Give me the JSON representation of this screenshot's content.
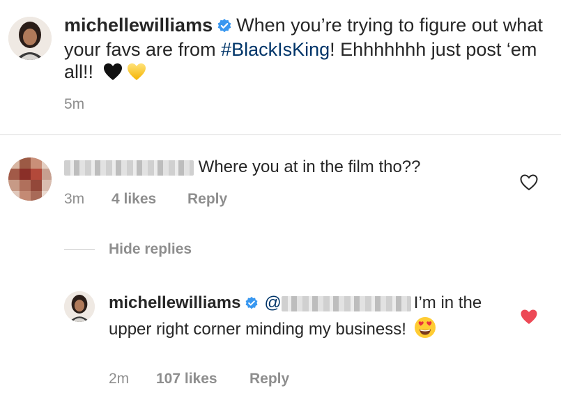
{
  "post": {
    "username": "michellewilliams",
    "caption_prefix": "When you’re trying to figure out what your favs are from ",
    "hashtag": "#BlackIsKing",
    "caption_suffix": "! Ehhhhhhh just post ‘em all!!",
    "emojis": [
      "black-heart-icon",
      "yellow-heart-icon"
    ],
    "time": "5m"
  },
  "comment": {
    "text": "Where you at in the film tho??",
    "time": "3m",
    "likes": "4 likes",
    "reply_label": "Reply"
  },
  "replies": {
    "toggle_label": "Hide replies"
  },
  "reply": {
    "username": "michellewilliams",
    "mention_prefix": "@",
    "text": "I’m in the upper right corner minding my business!",
    "emoji": "heart-eyes-icon",
    "time": "2m",
    "likes": "107 likes",
    "reply_label": "Reply",
    "liked": true
  },
  "colors": {
    "text": "#262626",
    "muted": "#8e8e8e",
    "verified": "#3897f0",
    "hashtag": "#003569",
    "liked_heart": "#ed4956"
  }
}
